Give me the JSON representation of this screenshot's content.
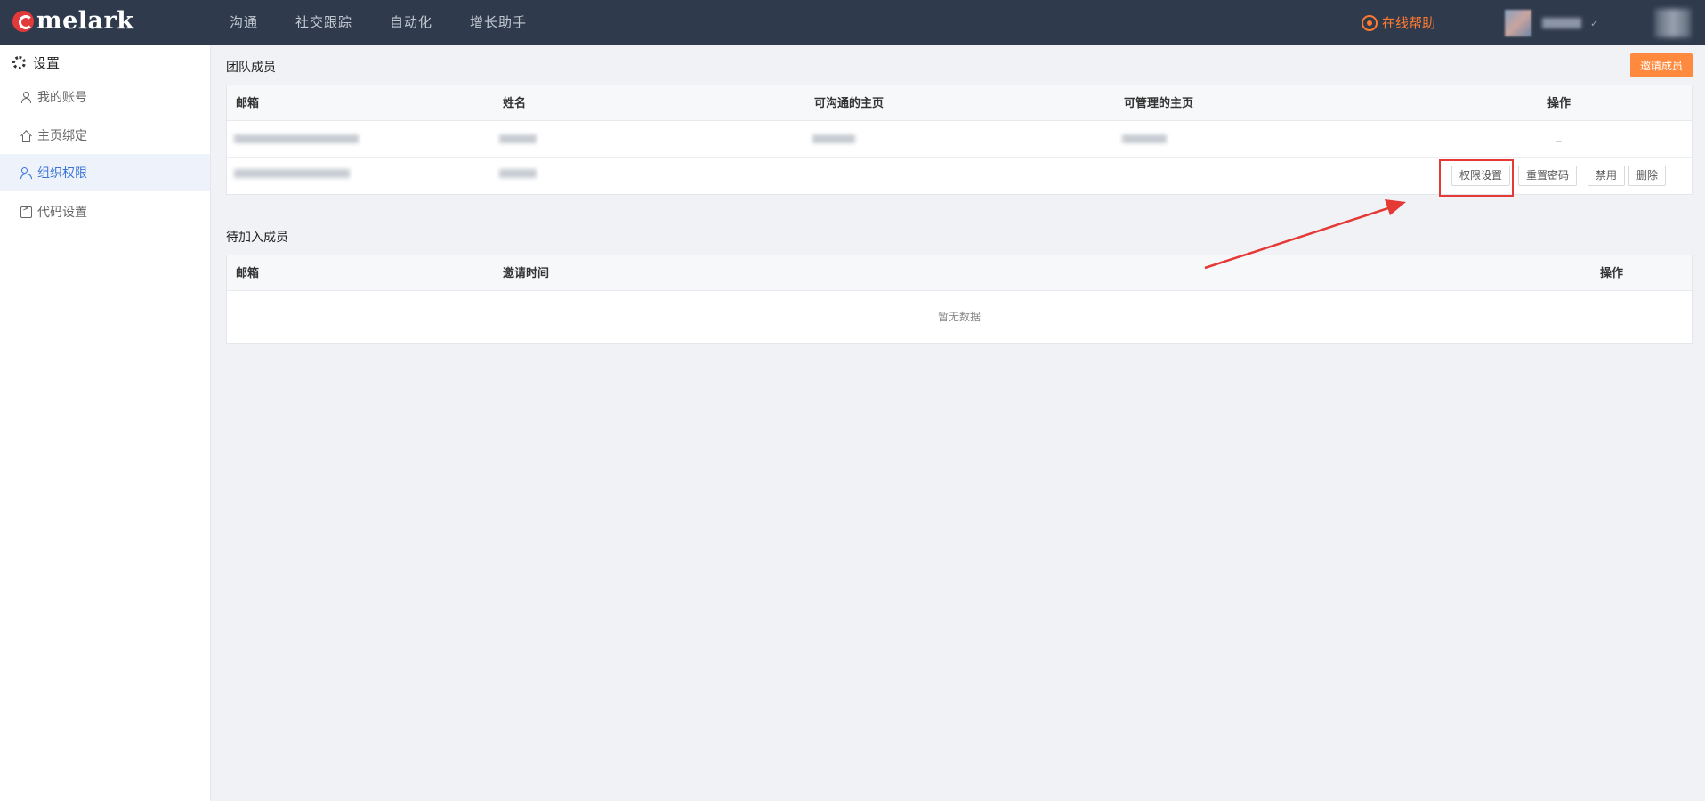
{
  "header": {
    "logo_text": "melark",
    "nav": [
      "沟通",
      "社交跟踪",
      "自动化",
      "增长助手"
    ],
    "help_label": "在线帮助",
    "user_caret": "✓"
  },
  "sidebar": {
    "title": "设置",
    "items": [
      {
        "label": "我的账号",
        "icon": "user-icon"
      },
      {
        "label": "主页绑定",
        "icon": "home-icon"
      },
      {
        "label": "组织权限",
        "icon": "team-icon",
        "active": true
      },
      {
        "label": "代码设置",
        "icon": "code-icon"
      }
    ]
  },
  "team": {
    "title": "团队成员",
    "invite_button": "邀请成员",
    "columns": [
      "邮箱",
      "姓名",
      "可沟通的主页",
      "可管理的主页",
      "操作"
    ],
    "rows": [
      {
        "action_text": "_"
      },
      {
        "actions": [
          "权限设置",
          "重置密码",
          "禁用",
          "删除"
        ]
      }
    ]
  },
  "pending": {
    "title": "待加入成员",
    "columns": [
      "邮箱",
      "邀请时间",
      "操作"
    ],
    "empty_text": "暂无数据"
  },
  "colors": {
    "topbar": "#2f3b4c",
    "accent_orange": "#ff8a3d",
    "active_blue": "#3a74d8",
    "annotation_red": "#e53935"
  }
}
